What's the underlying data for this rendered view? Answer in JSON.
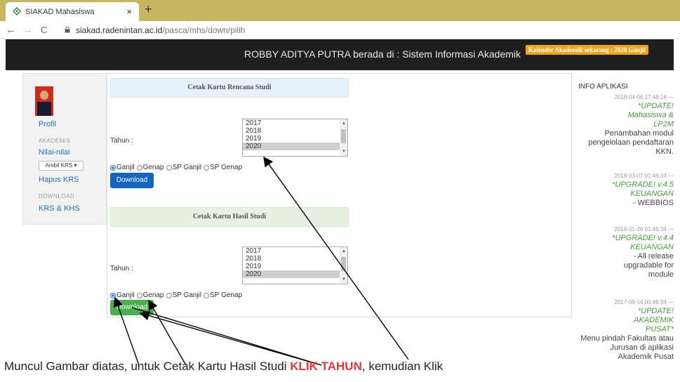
{
  "browser": {
    "tab_title": "SIAKAD Mahasiswa",
    "tab_close": "×",
    "new_tab": "+",
    "back": "←",
    "forward": "→",
    "reload": "C",
    "url_domain": "siakad.radenintan.ac.id",
    "url_path": "/pasca/mhs/down/pilih"
  },
  "header": {
    "text": "ROBBY ADITYA PUTRA berada di : Sistem Informasi Akademik",
    "calendar_badge": "Kalender Akademik sekarang : 2020 Ganjil"
  },
  "sidebar": {
    "profil": "Profil",
    "akademis_heading": "AKADEMIS",
    "nilai": "Nilai-nilai",
    "ambil_krs": "Ambil KRS",
    "hapus_krs": "Hapus KRS",
    "download_heading": "DOWNLOAD",
    "krs_khs": "KRS & KHS"
  },
  "krs_panel": {
    "title": "Cetak Kartu Rencana Studi",
    "tahun_label": "Tahun :",
    "years": [
      "2017",
      "2018",
      "2019",
      "2020"
    ],
    "selected_year": "2020",
    "radio_ganjil": "Ganjil",
    "radio_genap": "Genap",
    "radio_sp_ganjil": "SP Ganjil",
    "radio_sp_genap": "SP Genap",
    "download": "Download"
  },
  "khs_panel": {
    "title": "Cetak Kartu Hasil Studi",
    "tahun_label": "Tahun :",
    "years": [
      "2017",
      "2018",
      "2019",
      "2020"
    ],
    "selected_year": "2020",
    "radio_ganjil": "Ganjil",
    "radio_genap": "Genap",
    "radio_sp_ganjil": "SP Ganjil",
    "radio_sp_genap": "SP Genap",
    "download": "Download"
  },
  "info": {
    "title": "INFO APLIKASI",
    "items": [
      {
        "date": "2018-04-06 17:48:18 —",
        "highlight": "*UPDATE! Mahasiswa & LP2M",
        "text": "Penambahan modul pengelolaan pendaftaran KKN."
      },
      {
        "date": "2018-03-07 01:46:34 —",
        "highlight": "*UPGRADE! v.4.5 KEUANGAN",
        "text": "- WEBBIOS"
      },
      {
        "date": "2018-01-26 01:46:34 —",
        "highlight": "*UPGRADE! v.4.4 KEUANGAN",
        "text": "- All release upgradable for module"
      },
      {
        "date": "2017-09-14 00:46:34 —",
        "highlight": "*UPDATE! AKADEMIK PUSAT*",
        "text": "Menu pindah Fakultas atau Jurusan di aplikasi Akademik Pusat"
      }
    ]
  },
  "caption": {
    "before": "Muncul Gambar diatas, untuk Cetak Kartu Hasil Studi ",
    "highlight": "KLIK TAHUN",
    "after": ", kemudian Klik"
  }
}
